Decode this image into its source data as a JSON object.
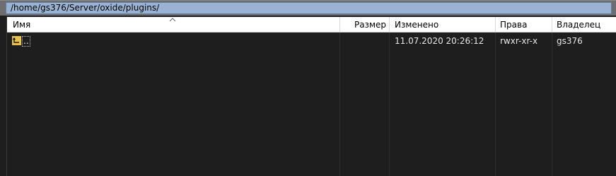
{
  "path_bar": {
    "path": "/home/gs376/Server/oxide/plugins/"
  },
  "columns": {
    "name": "Имя",
    "size": "Размер",
    "modified": "Изменено",
    "rights": "Права",
    "owner": "Владелец"
  },
  "sort": {
    "column": "name",
    "direction": "ascending"
  },
  "rows": [
    {
      "name": "..",
      "size": "",
      "modified": "11.07.2020 20:26:12",
      "rights": "rwxr-xr-x",
      "owner": "gs376",
      "icon": "parent-directory-icon"
    }
  ],
  "colors": {
    "path_highlight": "#9bb3d3",
    "list_background": "#1e1e1e",
    "folder_icon": "#e8c24c"
  }
}
